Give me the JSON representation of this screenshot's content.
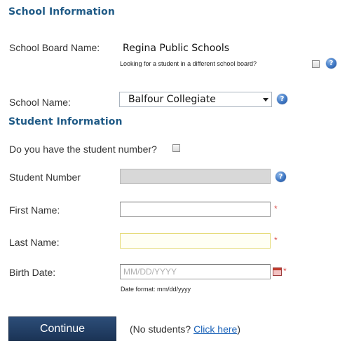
{
  "school_section": {
    "title": "School Information",
    "board_label": "School Board Name:",
    "board_value": "Regina Public Schools",
    "different_board_text": "Looking for a student in a different school board?",
    "school_label": "School Name:",
    "school_value": "Balfour Collegiate"
  },
  "student_section": {
    "title": "Student Information",
    "have_number_label": "Do you have the student number?",
    "student_number_label": "Student Number",
    "first_name_label": "First Name:",
    "last_name_label": "Last Name:",
    "birth_date_label": "Birth Date:",
    "birth_date_placeholder": "MM/DD/YYYY",
    "date_format_hint": "Date format: mm/dd/yyyy",
    "required_marker": "*"
  },
  "actions": {
    "continue_label": "Continue",
    "no_students_prefix": "(No students? ",
    "click_here_label": "Click here",
    "no_students_suffix": ")"
  },
  "help_icon_glyph": "?",
  "colors": {
    "section_title": "#1f5a86",
    "button": "#1b3456",
    "required": "#d9534f",
    "link": "#1a62b8"
  }
}
